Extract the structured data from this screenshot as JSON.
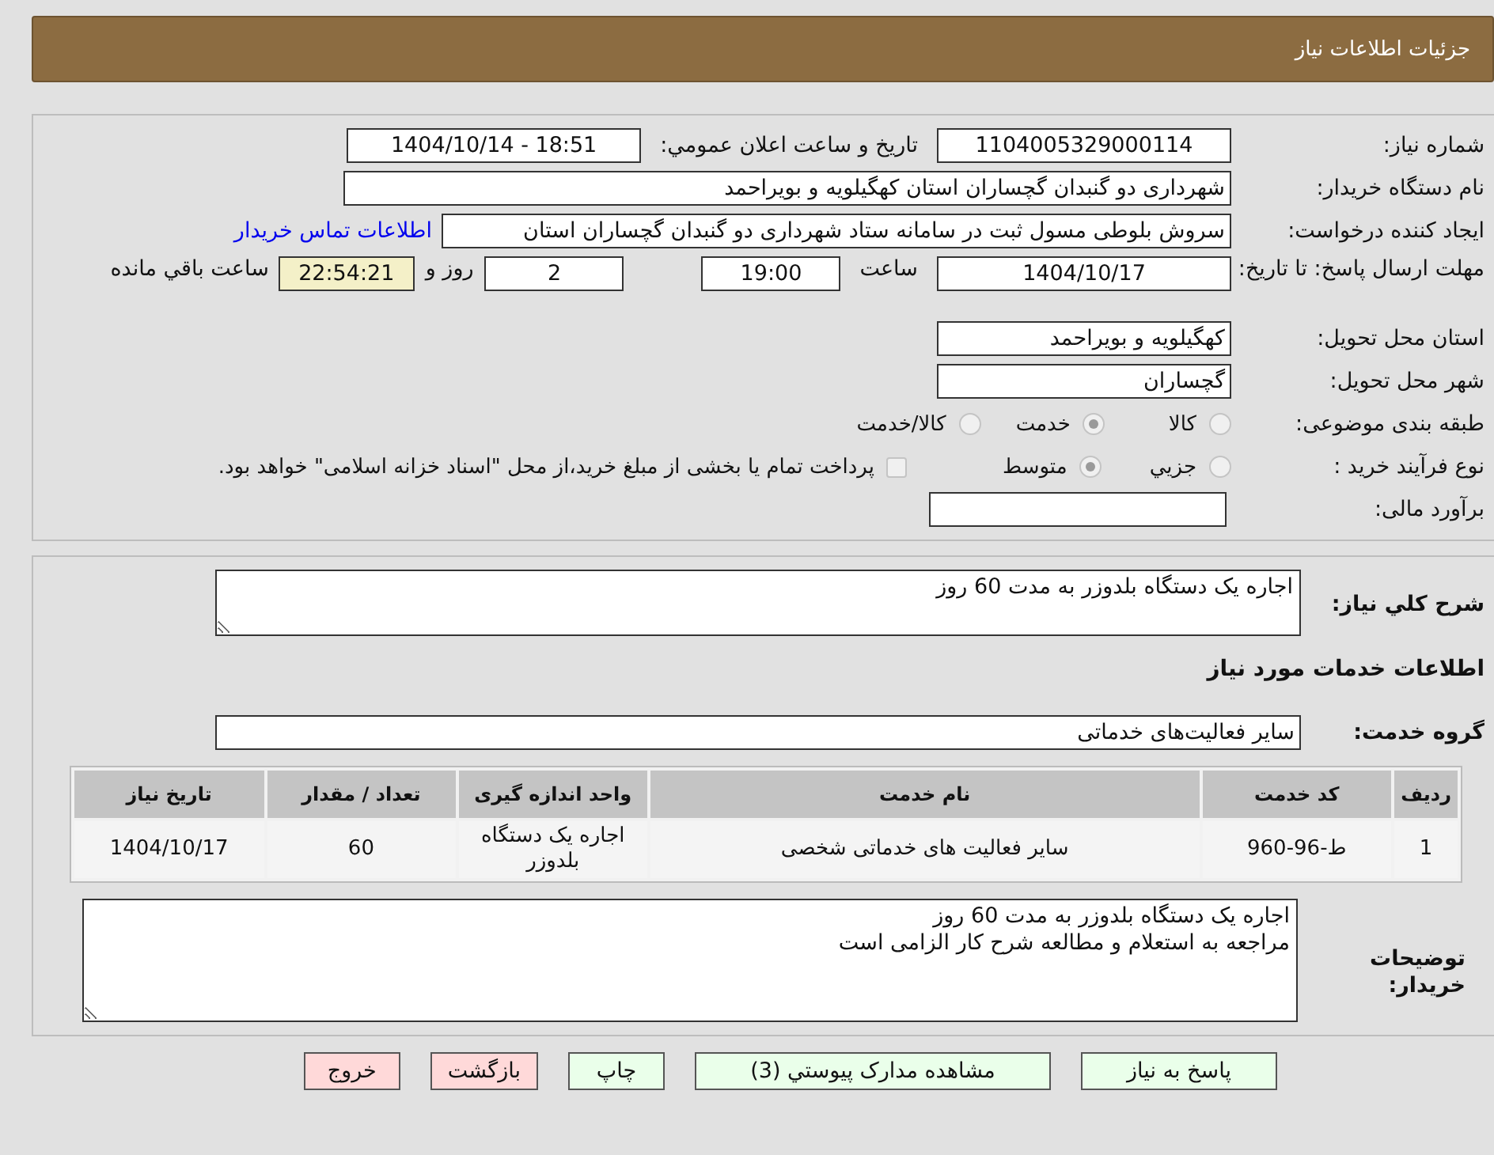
{
  "header": {
    "title": "جزئیات اطلاعات نیاز"
  },
  "details": {
    "need_number": {
      "label": "شماره نیاز:",
      "value": "1104005329000114"
    },
    "announce": {
      "label": "تاريخ و ساعت اعلان عمومي:",
      "value": "1404/10/14 - 18:51"
    },
    "buyer": {
      "label": "نام دستگاه خریدار:",
      "value": "شهرداری دو گنبدان گچساران استان کهگیلویه و بویراحمد"
    },
    "creator": {
      "label": "ایجاد کننده درخواست:",
      "value": "سروش بلوطی مسول ثبت در سامانه ستاد شهرداری دو گنبدان گچساران استان",
      "link": "اطلاعات تماس خریدار"
    },
    "deadline": {
      "label": "مهلت ارسال پاسخ: تا تاریخ:",
      "date": "1404/10/17",
      "time_label": "ساعت",
      "time": "19:00",
      "days": "2",
      "days_label": "روز و",
      "remaining": "22:54:21",
      "remaining_label": "ساعت باقي مانده"
    },
    "province": {
      "label": "استان محل تحویل:",
      "value": "کهگیلویه و بویراحمد"
    },
    "city": {
      "label": "شهر محل تحویل:",
      "value": "گچساران"
    },
    "category": {
      "label": "طبقه بندی موضوعی:",
      "options": [
        {
          "label": "کالا",
          "selected": false
        },
        {
          "label": "خدمت",
          "selected": true
        },
        {
          "label": "کالا/خدمت",
          "selected": false
        }
      ]
    },
    "process": {
      "label": "نوع فرآیند خرید :",
      "options": [
        {
          "label": "جزيي",
          "selected": false
        },
        {
          "label": "متوسط",
          "selected": true
        }
      ],
      "treasury": {
        "checked": false,
        "text": "پرداخت تمام یا بخشی از مبلغ خرید،از محل \"اسناد خزانه اسلامی\" خواهد بود."
      }
    },
    "estimate": {
      "label": "برآورد مالی:"
    }
  },
  "services": {
    "summary": {
      "label": "شرح کلي نياز:",
      "value": "اجاره یک دستگاه بلدوزر به مدت 60 روز"
    },
    "heading": "اطلاعات خدمات مورد نیاز",
    "group": {
      "label": "گروه خدمت:",
      "value": "سایر فعالیت‌های خدماتی"
    },
    "table": {
      "columns": [
        "ردیف",
        "کد خدمت",
        "نام خدمت",
        "واحد اندازه گیری",
        "تعداد / مقدار",
        "تاریخ نیاز"
      ],
      "rows": [
        [
          "1",
          "ط-96-960",
          "سایر فعالیت های خدماتی شخصی",
          "اجاره یک دستگاه بلدوزر",
          "60",
          "1404/10/17"
        ]
      ]
    },
    "buyer_notes": {
      "label": "توضیحات خریدار:",
      "lines": [
        "اجاره یک دستگاه بلدوزر به مدت 60 روز",
        "مراجعه به استعلام و مطالعه شرح کار الزامی است"
      ]
    }
  },
  "buttons": [
    {
      "label": "پاسخ به نیاز",
      "kind": "normal"
    },
    {
      "label": "مشاهده مدارک پیوستي (3)",
      "kind": "normal"
    },
    {
      "label": "چاپ",
      "kind": "normal"
    },
    {
      "label": "بازگشت",
      "kind": "danger"
    },
    {
      "label": "خروج",
      "kind": "danger"
    }
  ]
}
